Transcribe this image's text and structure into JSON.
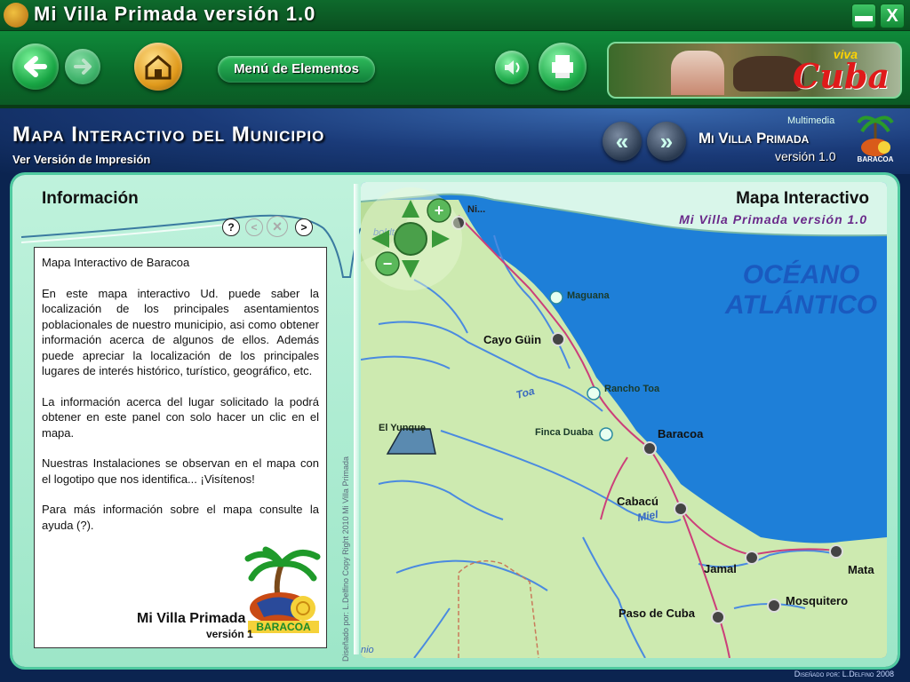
{
  "window": {
    "title": "Mi Villa Primada versión 1.0",
    "minimize_glyph": "▬",
    "close_glyph": "X"
  },
  "toolbar": {
    "menu_label": "Menú de Elementos",
    "banner": {
      "viva": "viva",
      "cuba": "Cuba"
    }
  },
  "header": {
    "title": "Mapa Interactivo del Municipio",
    "print_link": "Ver Versión de Impresión",
    "prev_glyph": "«",
    "next_glyph": "»",
    "multimedia": "Multimedia",
    "brand": "Mi Villa Primada",
    "brand_version": "versión 1.0",
    "logo_text": "BARACOA"
  },
  "info": {
    "title": "Información",
    "help": "?",
    "prev": "<",
    "stop": "×",
    "next": ">",
    "heading": "Mapa Interactivo de Baracoa",
    "paragraphs": [
      "En este mapa interactivo Ud. puede saber la localización de los principales asentamientos poblacionales de nuestro municipio, asi como obtener información acerca de algunos de ellos. Además puede apreciar la localización de los principales lugares de interés histórico, turístico, geográfico, etc.",
      "La información acerca del lugar solicitado la podrá obtener en este panel con solo hacer un clic en el mapa.",
      "Nuestras Instalaciones se observan en el mapa con el logotipo que nos identifica... ¡Visítenos!",
      "Para más información sobre el mapa consulte la ayuda (?)."
    ],
    "brand": "Mi Villa Primada",
    "version": "versión 1",
    "logo_text": "BARACOA"
  },
  "credit": "Diseñado por: L.Delfino Copy Right 2010 Mi Villa Primada",
  "map": {
    "title": "Mapa Interactivo",
    "subtitle": "Mi Villa Primada versión 1.0",
    "ocean_line1": "OCÉANO",
    "ocean_line2": "ATLÁNTICO",
    "river_labels": [
      "Toa",
      "Miel",
      "boldt",
      "nio"
    ],
    "places": [
      {
        "name": "Ni...",
        "kind": "town"
      },
      {
        "name": "Maguana",
        "kind": "poi"
      },
      {
        "name": "Cayo Güin",
        "kind": "town"
      },
      {
        "name": "Rancho Toa",
        "kind": "poi"
      },
      {
        "name": "Finca Duaba",
        "kind": "poi"
      },
      {
        "name": "Baracoa",
        "kind": "town"
      },
      {
        "name": "El Yunque",
        "kind": "mountain"
      },
      {
        "name": "Cabacú",
        "kind": "town"
      },
      {
        "name": "Jamal",
        "kind": "town"
      },
      {
        "name": "Mata",
        "kind": "town"
      },
      {
        "name": "Mosquitero",
        "kind": "town"
      },
      {
        "name": "Paso de Cuba",
        "kind": "town"
      }
    ],
    "controls": {
      "zoom_in": "+",
      "zoom_out": "−"
    }
  },
  "footer": "Diseñado por: L.Delfino 2008",
  "colors": {
    "land": "#cdeab0",
    "sea": "#1e7fd8",
    "road": "#cc3f7a",
    "river": "#4a8ae0",
    "brand": "#0a6a2a"
  }
}
